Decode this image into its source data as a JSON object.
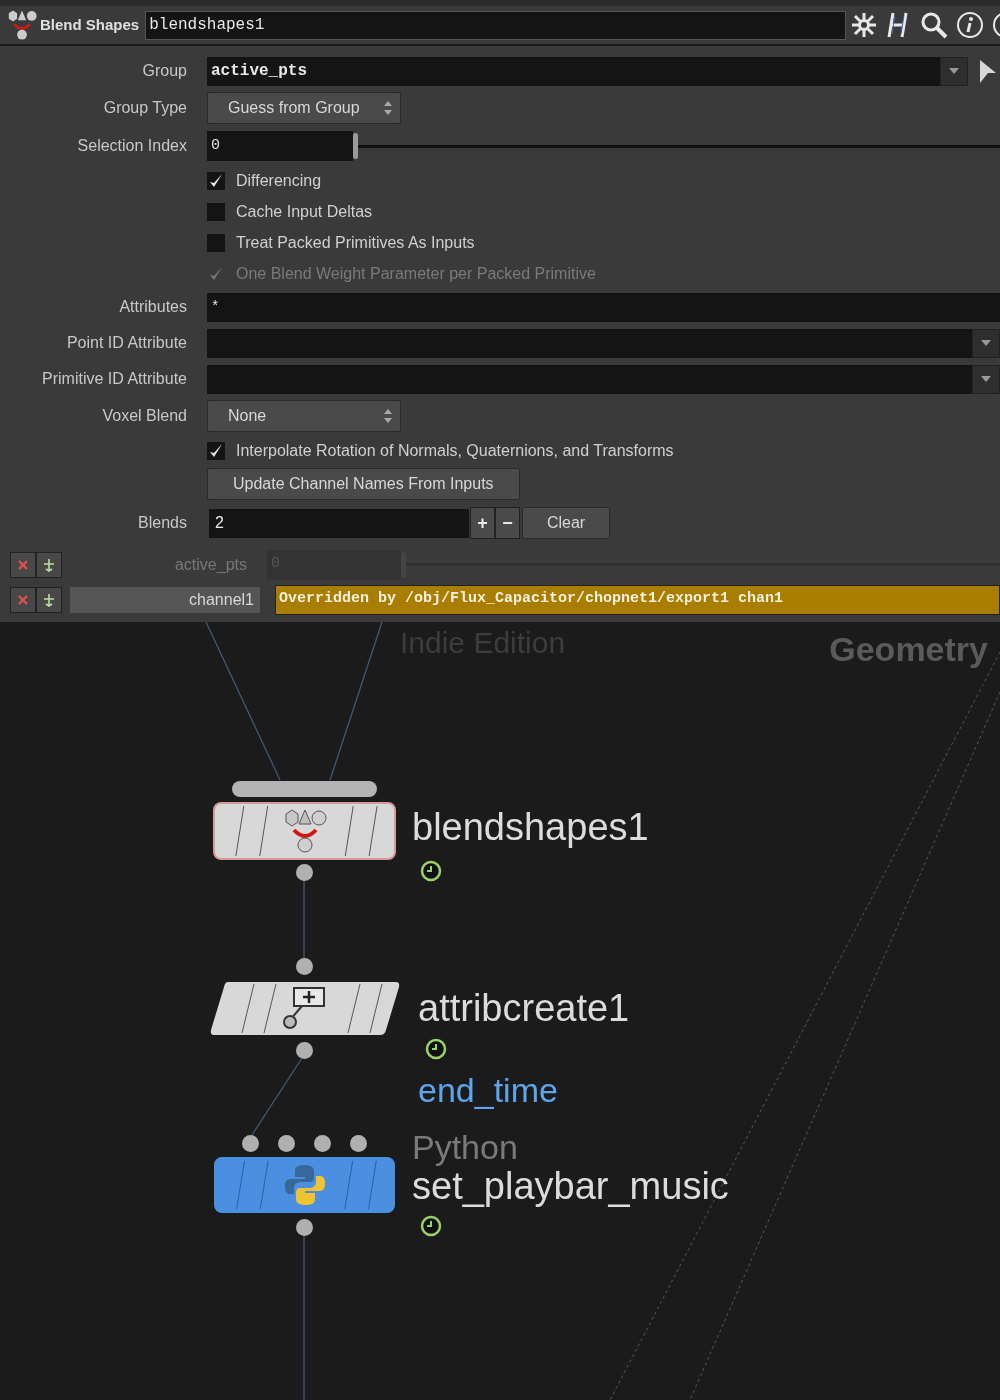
{
  "header": {
    "node_type": "Blend Shapes",
    "node_name": "blendshapes1"
  },
  "params": [
    {
      "kind": "text",
      "label": "Group",
      "value": "active_pts",
      "bold": true,
      "menu": true,
      "arrow": true
    },
    {
      "kind": "menu",
      "label": "Group Type",
      "value": "Guess from Group"
    },
    {
      "kind": "slider",
      "label": "Selection Index",
      "value": "0",
      "level": 0
    },
    {
      "kind": "checkbox",
      "label": "Differencing",
      "checked": true,
      "disabled": false
    },
    {
      "kind": "checkbox",
      "label": "Cache Input Deltas",
      "checked": false,
      "disabled": false
    },
    {
      "kind": "checkbox",
      "label": "Treat Packed Primitives As Inputs",
      "checked": false,
      "disabled": false
    },
    {
      "kind": "checkbox",
      "label": "One Blend Weight Parameter per Packed Primitive",
      "checked": true,
      "disabled": true
    },
    {
      "kind": "text",
      "label": "Attributes",
      "value": "*",
      "bold": false,
      "menu": false,
      "arrow": false
    },
    {
      "kind": "text",
      "label": "Point ID Attribute",
      "bold": false,
      "menu": true,
      "arrow": false
    },
    {
      "kind": "text",
      "label": "Primitive ID Attribute",
      "bold": false,
      "menu": true,
      "arrow": false
    },
    {
      "kind": "menu",
      "label": "Voxel Blend",
      "value": "None"
    },
    {
      "kind": "checkbox",
      "label": "Interpolate Rotation of Normals, Quaternions, and Transforms",
      "checked": true,
      "disabled": false
    },
    {
      "kind": "button",
      "label": "Update Channel Names From Inputs"
    },
    {
      "kind": "count",
      "label": "Blends",
      "value": "2",
      "plus": "+",
      "minus": "−",
      "clear": "Clear"
    }
  ],
  "blend_rows": [
    {
      "kind": "slider",
      "name": "active_pts",
      "value": "0",
      "level": 0,
      "disabled": true
    },
    {
      "kind": "override",
      "name": "channel1",
      "value": "Overridden by /obj/Flux_Capacitor/chopnet1/export1 chan1"
    }
  ],
  "network": {
    "edition": "Indie Edition",
    "context": "Geometry",
    "nodes": [
      {
        "kind": "blendshapes",
        "name": "blendshapes1",
        "selected": true
      },
      {
        "kind": "attribcreate",
        "name": "attribcreate1",
        "comment": "end_time",
        "selected": false
      },
      {
        "kind": "python",
        "type_label": "Python",
        "name": "set_playbar_music",
        "selected": false
      }
    ]
  }
}
